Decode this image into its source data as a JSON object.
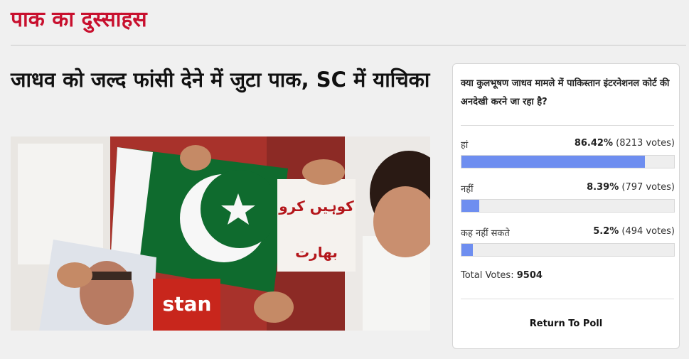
{
  "section": {
    "title": "पाक का दुस्साहस"
  },
  "article": {
    "headline": "जाधव को जल्द फांसी देने में जुटा पाक, SC में याचिका",
    "image_text": {
      "sign": "بھارت",
      "sign2": "کوہیں کرو",
      "banner": "stan"
    }
  },
  "poll": {
    "question": "क्या कुलभूषण जाधव मामले में पाकिस्तान इंटरनेशनल कोर्ट की अनदेखी करने जा रहा है?",
    "options": [
      {
        "label": "हां",
        "percent_text": "86.42%",
        "votes_text": "(8213 votes)",
        "percent": 86.42
      },
      {
        "label": "नहीं",
        "percent_text": "8.39%",
        "votes_text": "(797 votes)",
        "percent": 8.39
      },
      {
        "label": "कह नहीं सकते",
        "percent_text": "5.2%",
        "votes_text": "(494 votes)",
        "percent": 5.2
      }
    ],
    "total_label": "Total Votes:",
    "total_value": "9504",
    "return_label": "Return To Poll",
    "bar_color": "#6e8ef0"
  },
  "colors": {
    "brand": "#c8102e"
  }
}
